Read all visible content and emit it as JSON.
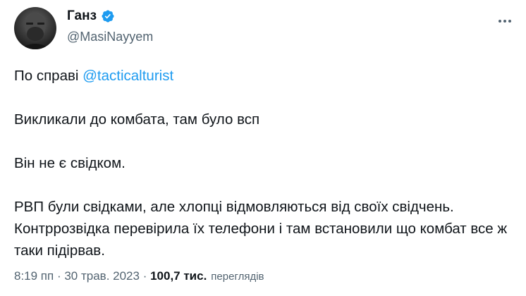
{
  "author": {
    "display_name": "Ганз",
    "handle": "@MasiNayyem"
  },
  "tweet": {
    "line1_prefix": "По справі ",
    "line1_mention": "@tacticalturist",
    "line2": "Викликали до комбата, там було всп",
    "line3": "Він не є свідком.",
    "line4": "РВП були свідками, але хлопці відмовляються від своїх свідчень. Контррозвідка перевірила їх телефони і там встановили що комбат все ж таки підірвав."
  },
  "meta": {
    "time": "8:19 пп",
    "separator": " · ",
    "date": "30 трав. 2023",
    "views_count": "100,7 тис.",
    "views_label": "переглядів"
  },
  "colors": {
    "accent": "#1d9bf0",
    "text": "#0f1419",
    "muted": "#536471"
  },
  "icons": [
    "avatar",
    "verified-badge-icon",
    "more-options-icon"
  ]
}
